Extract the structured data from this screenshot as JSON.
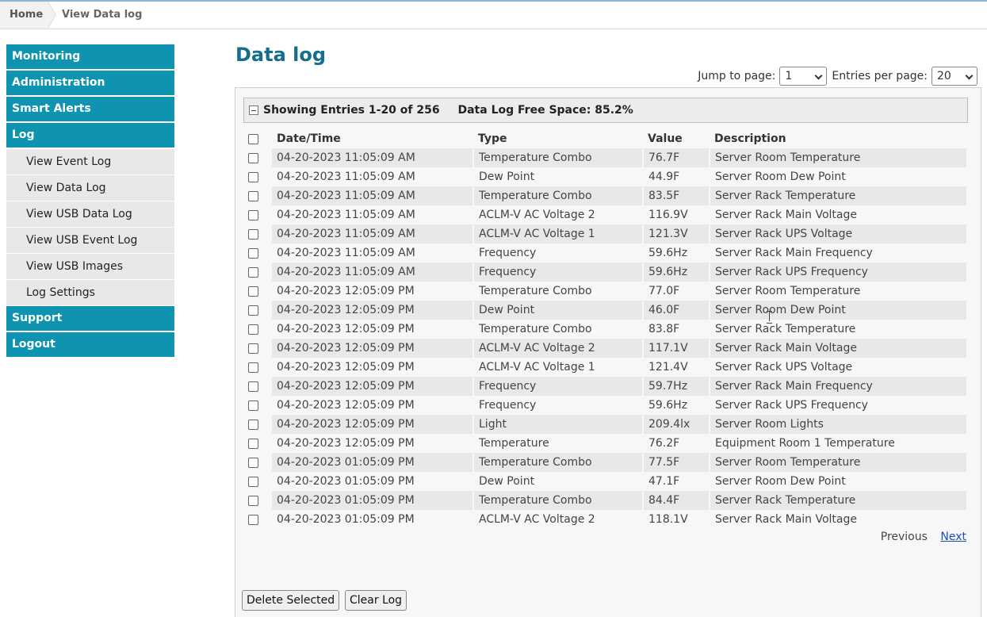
{
  "breadcrumb": {
    "home": "Home",
    "current": "View Data log"
  },
  "sidebar": {
    "items": [
      {
        "label": "Monitoring",
        "type": "main"
      },
      {
        "label": "Administration",
        "type": "main"
      },
      {
        "label": "Smart Alerts",
        "type": "main"
      },
      {
        "label": "Log",
        "type": "main"
      },
      {
        "label": "View Event Log",
        "type": "sub"
      },
      {
        "label": "View Data Log",
        "type": "sub"
      },
      {
        "label": "View USB Data Log",
        "type": "sub"
      },
      {
        "label": "View USB Event Log",
        "type": "sub"
      },
      {
        "label": "View USB Images",
        "type": "sub"
      },
      {
        "label": "Log Settings",
        "type": "sub"
      },
      {
        "label": "Support",
        "type": "main"
      },
      {
        "label": "Logout",
        "type": "main"
      }
    ]
  },
  "main": {
    "title": "Data log",
    "jump_label": "Jump to page:",
    "jump_value": "1",
    "entries_label": "Entries per page:",
    "entries_value": "20",
    "summary": "Showing Entries 1-20 of 256",
    "free_space": "Data Log Free Space: 85.2%",
    "columns": [
      "Date/Time",
      "Type",
      "Value",
      "Description"
    ],
    "rows": [
      [
        "04-20-2023 11:05:09 AM",
        "Temperature Combo",
        "76.7F",
        "Server Room Temperature"
      ],
      [
        "04-20-2023 11:05:09 AM",
        "Dew Point",
        "44.9F",
        "Server Room Dew Point"
      ],
      [
        "04-20-2023 11:05:09 AM",
        "Temperature Combo",
        "83.5F",
        "Server Rack Temperature"
      ],
      [
        "04-20-2023 11:05:09 AM",
        "ACLM-V AC Voltage 2",
        "116.9V",
        "Server Rack Main Voltage"
      ],
      [
        "04-20-2023 11:05:09 AM",
        "ACLM-V AC Voltage 1",
        "121.3V",
        "Server Rack UPS Voltage"
      ],
      [
        "04-20-2023 11:05:09 AM",
        "Frequency",
        "59.6Hz",
        "Server Rack Main Frequency"
      ],
      [
        "04-20-2023 11:05:09 AM",
        "Frequency",
        "59.6Hz",
        "Server Rack UPS Frequency"
      ],
      [
        "04-20-2023 12:05:09 PM",
        "Temperature Combo",
        "77.0F",
        "Server Room Temperature"
      ],
      [
        "04-20-2023 12:05:09 PM",
        "Dew Point",
        "46.0F",
        "Server Room Dew Point"
      ],
      [
        "04-20-2023 12:05:09 PM",
        "Temperature Combo",
        "83.8F",
        "Server Rack Temperature"
      ],
      [
        "04-20-2023 12:05:09 PM",
        "ACLM-V AC Voltage 2",
        "117.1V",
        "Server Rack Main Voltage"
      ],
      [
        "04-20-2023 12:05:09 PM",
        "ACLM-V AC Voltage 1",
        "121.4V",
        "Server Rack UPS Voltage"
      ],
      [
        "04-20-2023 12:05:09 PM",
        "Frequency",
        "59.7Hz",
        "Server Rack Main Frequency"
      ],
      [
        "04-20-2023 12:05:09 PM",
        "Frequency",
        "59.6Hz",
        "Server Rack UPS Frequency"
      ],
      [
        "04-20-2023 12:05:09 PM",
        "Light",
        "209.4lx",
        "Server Room Lights"
      ],
      [
        "04-20-2023 12:05:09 PM",
        "Temperature",
        "76.2F",
        "Equipment Room 1 Temperature"
      ],
      [
        "04-20-2023 01:05:09 PM",
        "Temperature Combo",
        "77.5F",
        "Server Room Temperature"
      ],
      [
        "04-20-2023 01:05:09 PM",
        "Dew Point",
        "47.1F",
        "Server Room Dew Point"
      ],
      [
        "04-20-2023 01:05:09 PM",
        "Temperature Combo",
        "84.4F",
        "Server Rack Temperature"
      ],
      [
        "04-20-2023 01:05:09 PM",
        "ACLM-V AC Voltage 2",
        "118.1V",
        "Server Rack Main Voltage"
      ]
    ],
    "previous_label": "Previous",
    "next_label": "Next",
    "delete_label": "Delete Selected",
    "clear_label": "Clear Log"
  },
  "colors": {
    "nav": "#0e93b0",
    "title": "#146e90",
    "link": "#1a4fb8"
  }
}
